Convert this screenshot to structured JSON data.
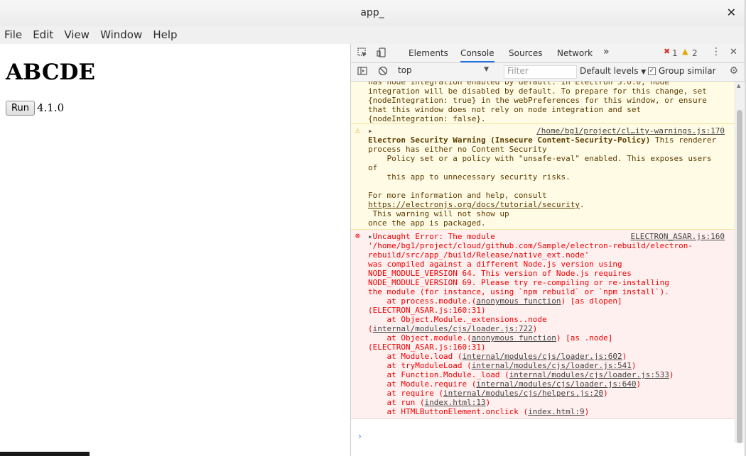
{
  "window": {
    "title": "app_",
    "close_glyph": "✕"
  },
  "menu": [
    "File",
    "Edit",
    "View",
    "Window",
    "Help"
  ],
  "page": {
    "heading": "ABCDE",
    "run_label": "Run",
    "version": "4.1.0"
  },
  "devtools": {
    "tabs": [
      "Elements",
      "Console",
      "Sources",
      "Network"
    ],
    "active_tab": "Console",
    "more_glyph": "»",
    "error_count": "1",
    "warning_count": "2",
    "context": "top",
    "filter_placeholder": "Filter",
    "levels": "Default levels",
    "group_similar": "Group similar"
  },
  "console": {
    "warning1_text": "has node integration enabled by default. In Electron 5.0.0, node\nintegration will be disabled by default. To prepare for this change, set\n{nodeIntegration: true} in the webPreferences for this window, or ensure\nthat this window does not rely on node integration and set\n{nodeIntegration: false}.",
    "warning2_src": "/home/bg1/project/cl…ity-warnings.js:170",
    "warning2_title": "Electron Security Warning (Insecure Content-Security-Policy)",
    "warning2_text": " This renderer\nprocess has either no Content Security\n    Policy set or a policy with \"unsafe-eval\" enabled. This exposes users\nof\n    this app to unnecessary security risks.\n\nFor more information and help, consult",
    "warning2_link": "https://electronjs.org/docs/tutorial/security",
    "warning2_tail": ".\n This warning will not show up\nonce the app is packaged.",
    "error_src": "ELECTRON_ASAR.js:160",
    "error_head": "Uncaught Error: The module",
    "error_body": "'/home/bg1/project/cloud/github.com/Sample/electron-rebuild/electron-\nrebuild/src/app_/build/Release/native_ext.node'\nwas compiled against a different Node.js version using\nNODE_MODULE_VERSION 64. This version of Node.js requires\nNODE_MODULE_VERSION 69. Please try re-compiling or re-installing\nthe module (for instance, using `npm rebuild` or `npm install`).",
    "stack": [
      {
        "pre": "    at process.module.(",
        "link": "anonymous function",
        "post": ") [as dlopen]\n(ELECTRON_ASAR.js:160:31)"
      },
      {
        "pre": "    at Object.Module._extensions..node\n(",
        "link": "internal/modules/cjs/loader.js:722",
        "post": ")"
      },
      {
        "pre": "    at Object.module.(",
        "link": "anonymous function",
        "post": ") [as .node]\n(ELECTRON_ASAR.js:160:31)"
      },
      {
        "pre": "    at Module.load (",
        "link": "internal/modules/cjs/loader.js:602",
        "post": ")"
      },
      {
        "pre": "    at tryModuleLoad (",
        "link": "internal/modules/cjs/loader.js:541",
        "post": ")"
      },
      {
        "pre": "    at Function.Module._load (",
        "link": "internal/modules/cjs/loader.js:533",
        "post": ")"
      },
      {
        "pre": "    at Module.require (",
        "link": "internal/modules/cjs/loader.js:640",
        "post": ")"
      },
      {
        "pre": "    at require (",
        "link": "internal/modules/cjs/helpers.js:20",
        "post": ")"
      },
      {
        "pre": "    at run (",
        "link": "index.html:13",
        "post": ")"
      },
      {
        "pre": "    at HTMLButtonElement.onclick (",
        "link": "index.html:9",
        "post": ")"
      }
    ]
  },
  "colors": {
    "warning_bg": "#fffbe5",
    "error_bg": "#fff0f0",
    "error_text": "#e00",
    "accent": "#1a73e8"
  }
}
